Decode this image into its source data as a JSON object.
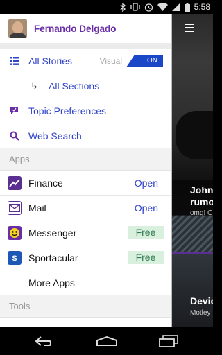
{
  "status_bar": {
    "time": "5:58"
  },
  "profile": {
    "name": "Fernando Delgado"
  },
  "menu": {
    "all_stories": "All Stories",
    "visual_label": "Visual",
    "toggle_state": "ON",
    "all_sections": "All Sections",
    "topic_preferences": "Topic Preferences",
    "web_search": "Web Search"
  },
  "apps": {
    "section_title": "Apps",
    "items": [
      {
        "label": "Finance",
        "action": "Open",
        "icon": "yahoo-finance-icon"
      },
      {
        "label": "Mail",
        "action": "Open",
        "icon": "yahoo-mail-icon"
      },
      {
        "label": "Messenger",
        "action": "Free",
        "icon": "yahoo-messenger-icon"
      },
      {
        "label": "Sportacular",
        "action": "Free",
        "icon": "sportacular-icon"
      }
    ],
    "more": "More Apps"
  },
  "tools": {
    "section_title": "Tools"
  },
  "background": {
    "card1_title": "John\nrumo",
    "card1_sub": "omg! C",
    "card2_title": "Devic",
    "card2_sub": "Motley"
  },
  "colors": {
    "accent_purple": "#6a2da8",
    "link_blue": "#2f43c7",
    "toggle_blue": "#1a47c8",
    "free_bg": "#d9f0df"
  }
}
